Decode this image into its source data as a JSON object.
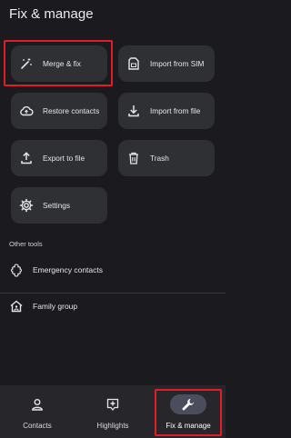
{
  "page_title": "Fix & manage",
  "cards": [
    {
      "label": "Merge & fix",
      "icon": "magic-wand-icon"
    },
    {
      "label": "Import from SIM",
      "icon": "sim-card-icon"
    },
    {
      "label": "Restore contacts",
      "icon": "cloud-upload-icon"
    },
    {
      "label": "Import from file",
      "icon": "download-icon"
    },
    {
      "label": "Export to file",
      "icon": "upload-icon"
    },
    {
      "label": "Trash",
      "icon": "trash-icon"
    },
    {
      "label": "Settings",
      "icon": "gear-icon"
    }
  ],
  "other_tools": {
    "heading": "Other tools",
    "items": [
      {
        "label": "Emergency contacts",
        "icon": "emergency-icon"
      },
      {
        "label": "Family group",
        "icon": "family-home-icon"
      }
    ]
  },
  "nav": [
    {
      "label": "Contacts",
      "icon": "person-icon",
      "active": false
    },
    {
      "label": "Highlights",
      "icon": "highlights-icon",
      "active": false
    },
    {
      "label": "Fix & manage",
      "icon": "wrench-icon",
      "active": true
    }
  ],
  "colors": {
    "highlight": "#e11d2a",
    "background": "#1b1b1f",
    "card": "#2f3034"
  }
}
